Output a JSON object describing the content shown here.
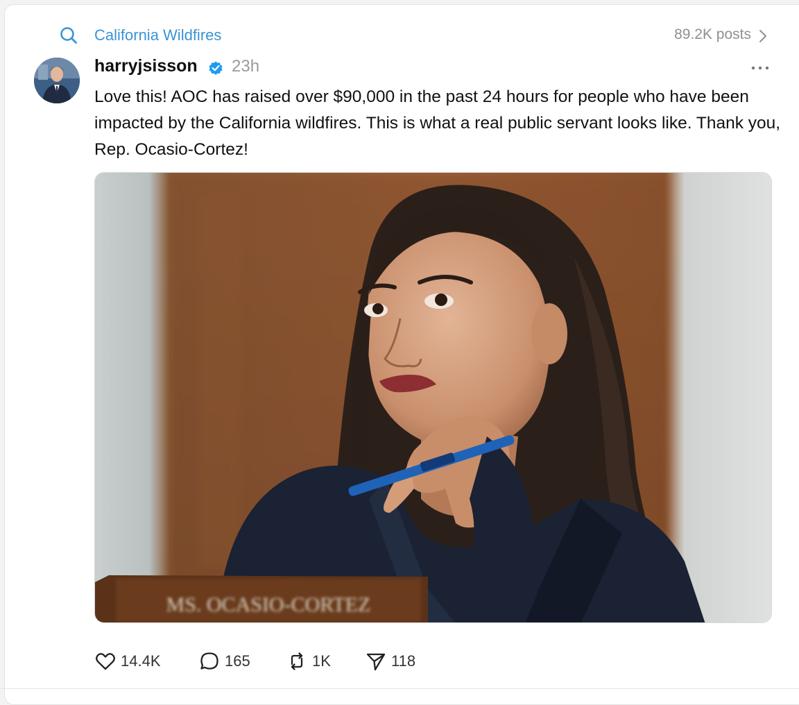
{
  "topic": {
    "label": "California Wildfires",
    "post_count": "89.2K posts",
    "icon": "search-icon",
    "accent_color": "#3a94d6"
  },
  "post": {
    "author": "harryjsisson",
    "verified": true,
    "time": "23h",
    "text": "Love this! AOC has raised over $90,000 in the past 24 hours for people who have been impacted by the California wildfires. This is what a real public servant looks like. Thank you, Rep. Ocasio-Cortez!",
    "image_nameplate": "MS. OCASIO-CORTEZ"
  },
  "actions": {
    "likes": "14.4K",
    "replies": "165",
    "reposts": "1K",
    "shares": "118"
  }
}
